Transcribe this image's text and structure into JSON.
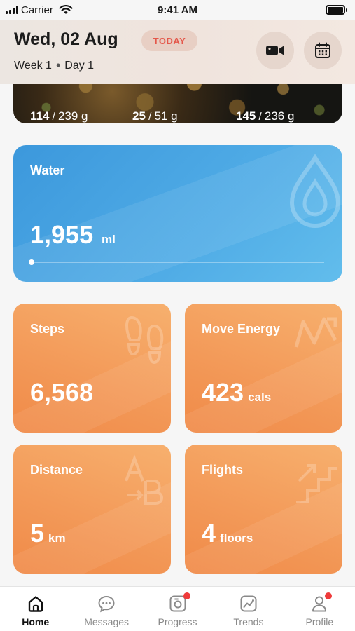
{
  "status_bar": {
    "carrier": "Carrier",
    "time": "9:41 AM"
  },
  "header": {
    "date": "Wed, 02 Aug",
    "today_badge": "TODAY",
    "week": "Week 1",
    "separator": "•",
    "day": "Day 1",
    "video_icon": "video-camera-icon",
    "calendar_icon": "calendar-icon"
  },
  "food": {
    "macros": [
      {
        "value": "114",
        "total": "239 g"
      },
      {
        "value": "25",
        "total": "51 g"
      },
      {
        "value": "145",
        "total": "236 g"
      }
    ]
  },
  "water": {
    "title": "Water",
    "value": "1,955",
    "unit": "ml",
    "progress_fraction": 0.005,
    "icon": "water-drop-icon"
  },
  "metrics": {
    "steps": {
      "title": "Steps",
      "value": "6,568",
      "unit": "",
      "icon": "footprints-icon"
    },
    "move": {
      "title": "Move Energy",
      "value": "423",
      "unit": "cals",
      "icon": "energy-bolt-icon"
    },
    "distance": {
      "title": "Distance",
      "value": "5",
      "unit": "km",
      "icon": "distance-a-to-b-icon"
    },
    "flights": {
      "title": "Flights",
      "value": "4",
      "unit": "floors",
      "icon": "stairs-icon"
    }
  },
  "tabs": [
    {
      "label": "Home",
      "icon": "home-icon",
      "active": true,
      "badge": false
    },
    {
      "label": "Messages",
      "icon": "chat-bubble-icon",
      "active": false,
      "badge": false
    },
    {
      "label": "Progress",
      "icon": "progress-camera-icon",
      "active": false,
      "badge": true
    },
    {
      "label": "Trends",
      "icon": "trend-chart-icon",
      "active": false,
      "badge": false
    },
    {
      "label": "Profile",
      "icon": "profile-icon",
      "active": false,
      "badge": true
    }
  ],
  "colors": {
    "water": "#4aa6e3",
    "metric": "#f39a59",
    "badge_text": "#e4574a",
    "notification": "#ef3b3b"
  }
}
